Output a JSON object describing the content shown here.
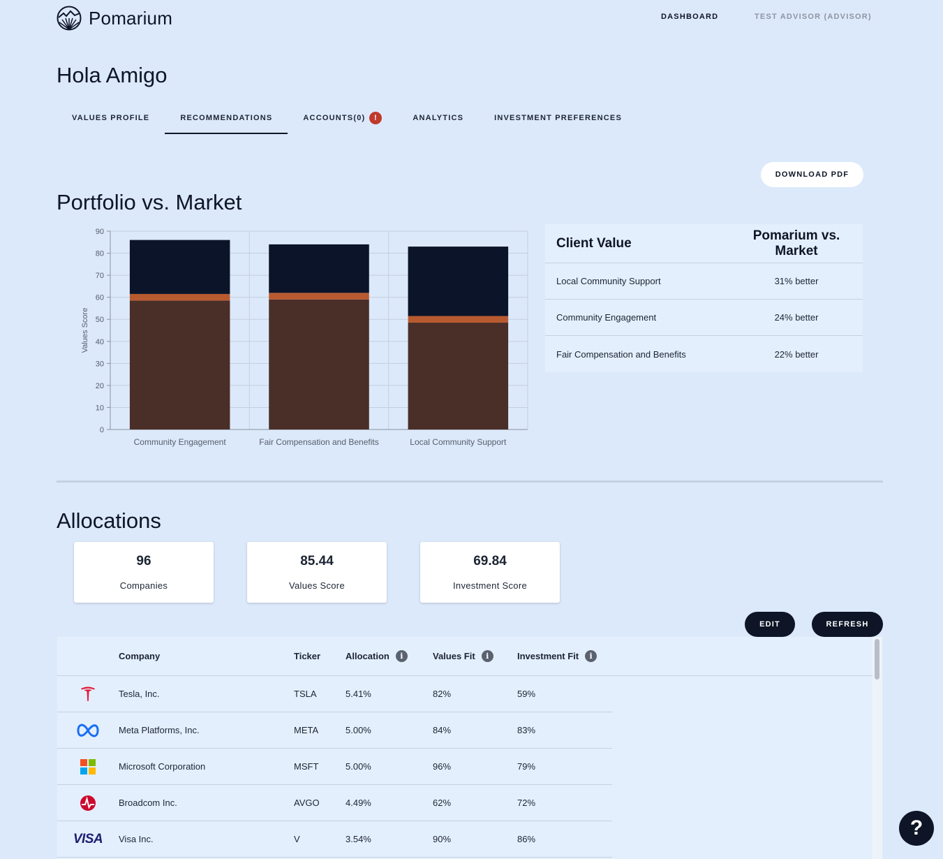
{
  "brand": {
    "name": "Pomarium"
  },
  "nav": {
    "dashboard": "DASHBOARD",
    "user": "TEST ADVISOR (ADVISOR)"
  },
  "page": {
    "title": "Hola Amigo"
  },
  "tabs": [
    {
      "label": "VALUES PROFILE"
    },
    {
      "label": "RECOMMENDATIONS"
    },
    {
      "label": "ACCOUNTS(0)",
      "badge": "!"
    },
    {
      "label": "ANALYTICS"
    },
    {
      "label": "INVESTMENT PREFERENCES"
    }
  ],
  "actions": {
    "download_pdf": "DOWNLOAD PDF",
    "edit": "EDIT",
    "refresh": "REFRESH",
    "help": "?"
  },
  "portfolio": {
    "title": "Portfolio vs. Market"
  },
  "chart_data": {
    "type": "bar",
    "stacked": true,
    "categories": [
      "Community Engagement",
      "Fair Compensation and Benefits",
      "Local Community Support"
    ],
    "series": [
      {
        "values": [
          58.5,
          59,
          48.5
        ],
        "color": "#4a2e28"
      },
      {
        "values": [
          3,
          3,
          3
        ],
        "color": "#b85a2f"
      },
      {
        "values": [
          24.5,
          22,
          31.5
        ],
        "color": "#0b1428"
      }
    ],
    "ylabel": "Values Score",
    "xlabel": "",
    "ylim": [
      0,
      90
    ],
    "yticks": [
      0,
      10,
      20,
      30,
      40,
      50,
      60,
      70,
      80,
      90
    ],
    "grid": true
  },
  "client_values": {
    "headers": {
      "value": "Client Value",
      "compare": "Pomarium vs. Market"
    },
    "rows": [
      {
        "value": "Local Community Support",
        "compare": "31% better"
      },
      {
        "value": "Community Engagement",
        "compare": "24% better"
      },
      {
        "value": "Fair Compensation and Benefits",
        "compare": "22% better"
      }
    ]
  },
  "allocations": {
    "title": "Allocations",
    "stats": [
      {
        "value": "96",
        "label": "Companies"
      },
      {
        "value": "85.44",
        "label": "Values Score"
      },
      {
        "value": "69.84",
        "label": "Investment Score"
      }
    ],
    "headers": {
      "company": "Company",
      "ticker": "Ticker",
      "allocation": "Allocation",
      "values_fit": "Values Fit",
      "investment_fit": "Investment Fit",
      "info": "i"
    },
    "rows": [
      {
        "logo": "tesla-logo",
        "company": "Tesla, Inc.",
        "ticker": "TSLA",
        "allocation": "5.41%",
        "values_fit": "82%",
        "investment_fit": "59%"
      },
      {
        "logo": "meta-logo",
        "company": "Meta Platforms, Inc.",
        "ticker": "META",
        "allocation": "5.00%",
        "values_fit": "84%",
        "investment_fit": "83%"
      },
      {
        "logo": "microsoft-logo",
        "company": "Microsoft Corporation",
        "ticker": "MSFT",
        "allocation": "5.00%",
        "values_fit": "96%",
        "investment_fit": "79%"
      },
      {
        "logo": "broadcom-logo",
        "company": "Broadcom Inc.",
        "ticker": "AVGO",
        "allocation": "4.49%",
        "values_fit": "62%",
        "investment_fit": "72%"
      },
      {
        "logo": "visa-logo",
        "company": "Visa Inc.",
        "ticker": "V",
        "allocation": "3.54%",
        "values_fit": "90%",
        "investment_fit": "86%",
        "logo_text": "VISA"
      }
    ]
  }
}
